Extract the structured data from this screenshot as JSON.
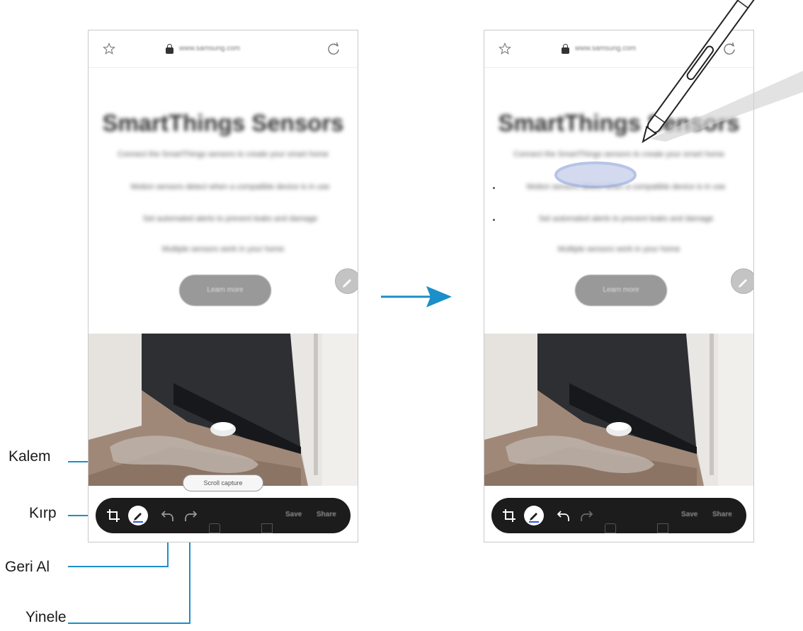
{
  "browser": {
    "url_text": "www.samsung.com"
  },
  "page": {
    "headline": "SmartThings Sensors",
    "subheadline": "Connect the SmartThings sensors to create your smart home",
    "bullets": [
      "Motion sensors detect when a compatible device is in use",
      "Set automated alerts to prevent leaks and damage",
      "Multiple sensors work in your home"
    ],
    "cta_label": "Learn more"
  },
  "scroll_capture_label": "Scroll capture",
  "toolbar": {
    "save_label": "Save",
    "share_label": "Share"
  },
  "callouts": {
    "pen": "Kalem",
    "crop": "Kırp",
    "undo": "Geri Al",
    "redo": "Yinele"
  },
  "colors": {
    "callout_line": "#1b8fc8",
    "arrow": "#1b8fc8",
    "toolbar_bg": "#1c1c1c"
  }
}
